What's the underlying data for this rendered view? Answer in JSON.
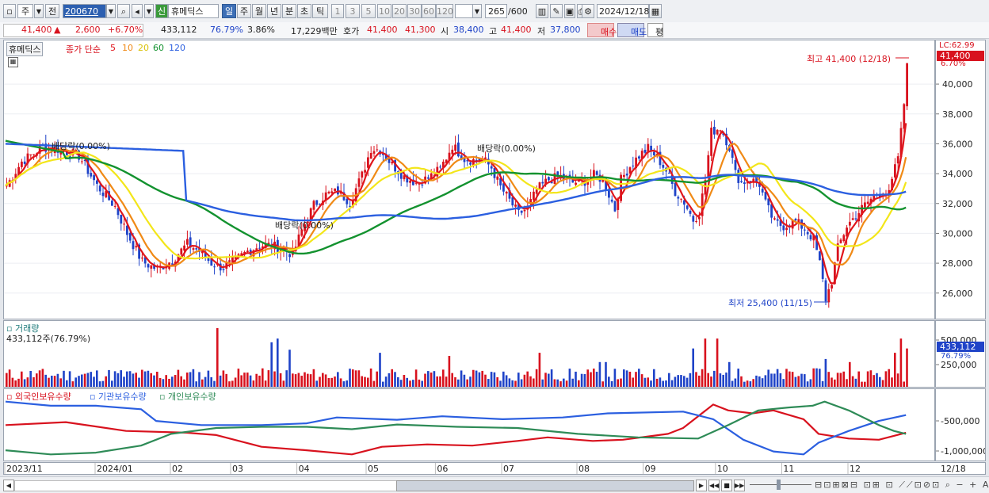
{
  "toolbar": {
    "period_labels": [
      "주",
      "전"
    ],
    "stock_code": "200670",
    "stock_badge": "신",
    "stock_name": "휴메딕스",
    "timeframes": [
      "일",
      "주",
      "월",
      "년",
      "분",
      "초",
      "틱"
    ],
    "numbers": [
      "1",
      "3",
      "5",
      "10",
      "20",
      "30",
      "60",
      "120"
    ],
    "count": "265",
    "count_total": "/600",
    "date": "2024/12/18"
  },
  "info": {
    "price": "41,400",
    "arrow": "▲",
    "change": "2,600",
    "change_pct": "+6.70%",
    "volume": "433,112",
    "vol_ratio": "76.79%",
    "turnover": "3.86%",
    "amount": "17,229백만",
    "quote_label": "호가",
    "ask": "41,400",
    "bid": "41,300",
    "open_label": "시",
    "open": "38,400",
    "high_label": "고",
    "high": "41,400",
    "low_label": "저",
    "low": "37,800",
    "buy_btn": "매수",
    "sell_btn": "매도",
    "eval_btn": "평"
  },
  "legend": {
    "name": "휴메딕스",
    "ma_label": "종가 단순",
    "periods": [
      "5",
      "10",
      "20",
      "60",
      "120"
    ],
    "colors": [
      "#e0161c",
      "#f08a16",
      "#f3e61a",
      "#13922f",
      "#2b5fe0"
    ]
  },
  "price_panel": {
    "top_tag": "LC:62.99",
    "current_tag": "41,400",
    "current_pct": "6.70%",
    "max_label": "최고 41,400 (12/18)",
    "min_label": "최저 25,400 (11/15)",
    "dividend_labels": [
      "배당락(0.00%)",
      "배당락(0.00%)",
      "배당락(0.00%)"
    ]
  },
  "volume_panel": {
    "title": "거래량",
    "value": "433,112주(76.79%)",
    "tag": "433,112",
    "tag_pct": "76.79%"
  },
  "holding_panel": {
    "legend": [
      "외국인보유수량",
      "기관보유수량",
      "개인보유수량"
    ],
    "colors": [
      "#d8121e",
      "#2b5fe0",
      "#2e8b57"
    ]
  },
  "x_axis_labels": [
    "2023/11",
    "2024/01",
    "02",
    "03",
    "04",
    "05",
    "06",
    "07",
    "08",
    "09",
    "10",
    "11",
    "12"
  ],
  "x_axis_end": "12/18",
  "chart_data": {
    "type": "candlestick",
    "period": "daily",
    "ylim": [
      24500,
      42500
    ],
    "price_ticks": [
      26000,
      28000,
      30000,
      32000,
      34000,
      36000,
      38000,
      40000
    ],
    "volume_ticks": [
      "250,000",
      "500,000"
    ],
    "holding_ticks": [
      "-500,000",
      "-1,000,000"
    ],
    "price_keypoints": [
      [
        0,
        33200
      ],
      [
        5,
        34800
      ],
      [
        12,
        35800
      ],
      [
        18,
        35600
      ],
      [
        24,
        35200
      ],
      [
        30,
        33200
      ],
      [
        36,
        31800
      ],
      [
        40,
        30000
      ],
      [
        45,
        28100
      ],
      [
        50,
        27600
      ],
      [
        55,
        28200
      ],
      [
        60,
        29300
      ],
      [
        64,
        28800
      ],
      [
        68,
        28000
      ],
      [
        72,
        27700
      ],
      [
        76,
        28200
      ],
      [
        80,
        28800
      ],
      [
        84,
        29200
      ],
      [
        88,
        29200
      ],
      [
        92,
        28900
      ],
      [
        95,
        28600
      ],
      [
        98,
        30200
      ],
      [
        102,
        31900
      ],
      [
        106,
        32600
      ],
      [
        110,
        32800
      ],
      [
        114,
        32100
      ],
      [
        118,
        33900
      ],
      [
        121,
        35700
      ],
      [
        124,
        35600
      ],
      [
        128,
        34600
      ],
      [
        132,
        33800
      ],
      [
        136,
        33400
      ],
      [
        140,
        33700
      ],
      [
        144,
        34300
      ],
      [
        148,
        35900
      ],
      [
        152,
        35000
      ],
      [
        155,
        34900
      ],
      [
        158,
        35000
      ],
      [
        161,
        34400
      ],
      [
        164,
        33100
      ],
      [
        167,
        32200
      ],
      [
        170,
        31300
      ],
      [
        173,
        31700
      ],
      [
        176,
        32900
      ],
      [
        180,
        33600
      ],
      [
        184,
        33800
      ],
      [
        188,
        33400
      ],
      [
        192,
        33500
      ],
      [
        195,
        33900
      ],
      [
        198,
        33600
      ],
      [
        200,
        32600
      ],
      [
        202,
        31600
      ],
      [
        204,
        33600
      ],
      [
        207,
        34500
      ],
      [
        210,
        35200
      ],
      [
        213,
        35700
      ],
      [
        216,
        35100
      ],
      [
        219,
        34200
      ],
      [
        222,
        32800
      ],
      [
        225,
        32100
      ],
      [
        228,
        30900
      ],
      [
        230,
        31400
      ],
      [
        232,
        33600
      ],
      [
        234,
        36800
      ],
      [
        237,
        37100
      ],
      [
        240,
        35800
      ],
      [
        242,
        34000
      ],
      [
        244,
        33400
      ],
      [
        247,
        33600
      ],
      [
        250,
        33300
      ],
      [
        252,
        32000
      ],
      [
        255,
        30700
      ],
      [
        258,
        30500
      ],
      [
        262,
        30800
      ],
      [
        265,
        30300
      ],
      [
        268,
        29600
      ],
      [
        270,
        28000
      ],
      [
        272,
        25600
      ],
      [
        274,
        26800
      ],
      [
        276,
        29000
      ],
      [
        279,
        30500
      ],
      [
        282,
        31200
      ],
      [
        285,
        31900
      ],
      [
        288,
        32500
      ],
      [
        291,
        32800
      ],
      [
        293,
        32600
      ],
      [
        296,
        35200
      ],
      [
        297,
        36800
      ],
      [
        298,
        38700
      ],
      [
        299,
        41400
      ]
    ],
    "price_seed": 7,
    "volume_seed": 11,
    "volume_spikes": [
      [
        70,
        0.95
      ],
      [
        88,
        0.72
      ],
      [
        90,
        0.78
      ],
      [
        94,
        0.6
      ],
      [
        124,
        0.55
      ],
      [
        147,
        0.5
      ],
      [
        177,
        0.55
      ],
      [
        197,
        0.4
      ],
      [
        199,
        0.4
      ],
      [
        228,
        0.62
      ],
      [
        232,
        0.78
      ],
      [
        236,
        0.78
      ],
      [
        240,
        0.4
      ],
      [
        272,
        0.45
      ],
      [
        280,
        0.4
      ],
      [
        295,
        0.55
      ],
      [
        297,
        0.78
      ],
      [
        299,
        0.62
      ]
    ],
    "holding_series": {
      "foreign": [
        [
          0,
          0.45
        ],
        [
          20,
          0.4
        ],
        [
          40,
          0.55
        ],
        [
          60,
          0.58
        ],
        [
          70,
          0.62
        ],
        [
          85,
          0.82
        ],
        [
          100,
          0.88
        ],
        [
          115,
          0.95
        ],
        [
          125,
          0.82
        ],
        [
          140,
          0.78
        ],
        [
          155,
          0.8
        ],
        [
          170,
          0.72
        ],
        [
          180,
          0.66
        ],
        [
          195,
          0.72
        ],
        [
          205,
          0.7
        ],
        [
          220,
          0.6
        ],
        [
          225,
          0.5
        ],
        [
          235,
          0.1
        ],
        [
          240,
          0.2
        ],
        [
          248,
          0.25
        ],
        [
          255,
          0.2
        ],
        [
          265,
          0.35
        ],
        [
          270,
          0.6
        ],
        [
          280,
          0.68
        ],
        [
          290,
          0.7
        ],
        [
          296,
          0.62
        ],
        [
          299,
          0.58
        ]
      ],
      "institution": [
        [
          0,
          0.05
        ],
        [
          15,
          0.12
        ],
        [
          30,
          0.12
        ],
        [
          45,
          0.18
        ],
        [
          50,
          0.38
        ],
        [
          65,
          0.45
        ],
        [
          85,
          0.45
        ],
        [
          100,
          0.42
        ],
        [
          110,
          0.32
        ],
        [
          130,
          0.36
        ],
        [
          145,
          0.3
        ],
        [
          165,
          0.35
        ],
        [
          185,
          0.32
        ],
        [
          200,
          0.25
        ],
        [
          225,
          0.22
        ],
        [
          235,
          0.35
        ],
        [
          245,
          0.7
        ],
        [
          255,
          0.9
        ],
        [
          265,
          0.95
        ],
        [
          270,
          0.75
        ],
        [
          280,
          0.55
        ],
        [
          290,
          0.38
        ],
        [
          299,
          0.28
        ]
      ],
      "individual": [
        [
          0,
          0.88
        ],
        [
          15,
          0.95
        ],
        [
          30,
          0.92
        ],
        [
          45,
          0.8
        ],
        [
          55,
          0.6
        ],
        [
          70,
          0.5
        ],
        [
          85,
          0.48
        ],
        [
          100,
          0.48
        ],
        [
          115,
          0.52
        ],
        [
          130,
          0.44
        ],
        [
          150,
          0.48
        ],
        [
          170,
          0.5
        ],
        [
          190,
          0.6
        ],
        [
          210,
          0.66
        ],
        [
          230,
          0.68
        ],
        [
          240,
          0.45
        ],
        [
          250,
          0.2
        ],
        [
          260,
          0.15
        ],
        [
          268,
          0.12
        ],
        [
          272,
          0.05
        ],
        [
          280,
          0.2
        ],
        [
          290,
          0.45
        ],
        [
          295,
          0.55
        ],
        [
          299,
          0.6
        ]
      ]
    }
  }
}
